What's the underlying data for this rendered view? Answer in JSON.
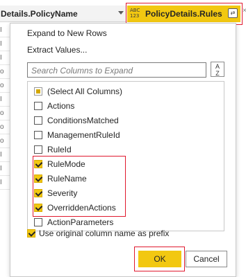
{
  "header": {
    "left_column_title": "Details.PolicyName",
    "active_column_type": "ABC\n123",
    "active_column_title": "PolicyDetails.Rules",
    "expand_icon": "expand-columns-icon"
  },
  "menu": {
    "expand_to_new_rows": "Expand to New Rows",
    "extract_values": "Extract Values..."
  },
  "search": {
    "placeholder": "Search Columns to Expand",
    "sort_label": "A\nZ"
  },
  "columns": [
    {
      "label": "(Select All Columns)",
      "state": "partial"
    },
    {
      "label": "Actions",
      "state": "unchecked"
    },
    {
      "label": "ConditionsMatched",
      "state": "unchecked"
    },
    {
      "label": "ManagementRuleId",
      "state": "unchecked"
    },
    {
      "label": "RuleId",
      "state": "unchecked"
    },
    {
      "label": "RuleMode",
      "state": "checked"
    },
    {
      "label": "RuleName",
      "state": "checked"
    },
    {
      "label": "Severity",
      "state": "checked"
    },
    {
      "label": "OverriddenActions",
      "state": "checked"
    },
    {
      "label": "ActionParameters",
      "state": "unchecked"
    }
  ],
  "prefix_option": {
    "label": "Use original column name as prefix",
    "checked": true
  },
  "buttons": {
    "ok": "OK",
    "cancel": "Cancel"
  },
  "left_stubs": [
    "I",
    "I",
    "I",
    "o",
    "o",
    "I",
    "o",
    "o",
    "o",
    "I",
    "I",
    "I"
  ],
  "colors": {
    "accent": "#f2c811",
    "highlight": "#e0182d"
  }
}
